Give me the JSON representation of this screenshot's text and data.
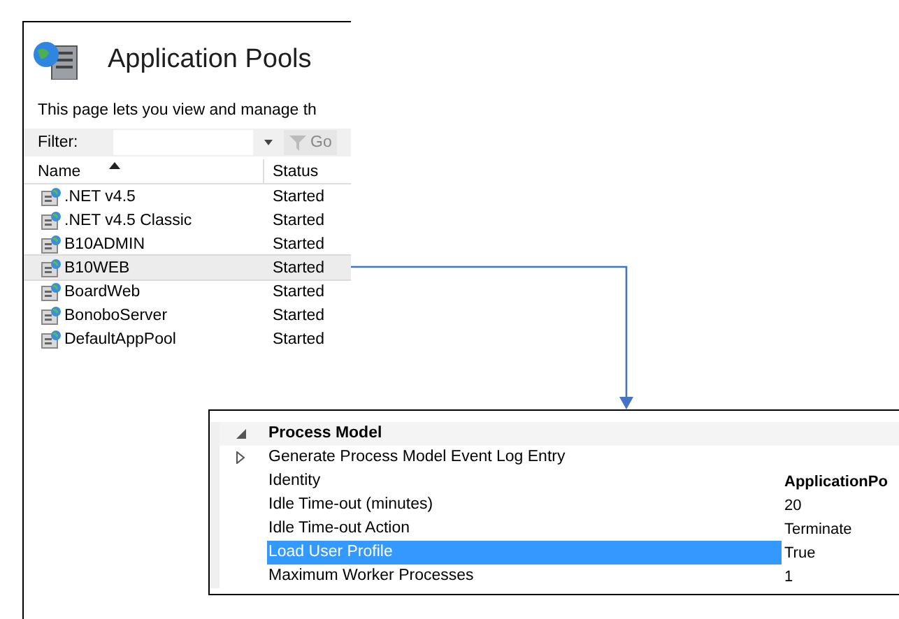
{
  "pools_panel": {
    "title": "Application Pools",
    "description": "This page lets you view and manage th",
    "filter": {
      "label": "Filter:",
      "go": "Go"
    },
    "columns": [
      {
        "label": "Name",
        "sorted": true
      },
      {
        "label": "Status",
        "sorted": false
      }
    ],
    "rows": [
      {
        "name": ".NET v4.5",
        "status": "Started",
        "selected": false
      },
      {
        "name": ".NET v4.5 Classic",
        "status": "Started",
        "selected": false
      },
      {
        "name": "B10ADMIN",
        "status": "Started",
        "selected": false
      },
      {
        "name": "B10WEB",
        "status": "Started",
        "selected": true
      },
      {
        "name": "BoardWeb",
        "status": "Started",
        "selected": false
      },
      {
        "name": "BonoboServer",
        "status": "Started",
        "selected": false
      },
      {
        "name": "DefaultAppPool",
        "status": "Started",
        "selected": false
      }
    ]
  },
  "settings_panel": {
    "rows": [
      {
        "kind": "section",
        "name": "Process Model",
        "expanded": true,
        "selected": false
      },
      {
        "kind": "collapsed",
        "name": "Generate Process Model Event Log Entry",
        "selected": false
      },
      {
        "kind": "setting",
        "name": "Identity",
        "value": "ApplicationPo",
        "bold_value": true,
        "selected": false
      },
      {
        "kind": "setting",
        "name": "Idle Time-out (minutes)",
        "value": "20",
        "selected": false
      },
      {
        "kind": "setting",
        "name": "Idle Time-out Action",
        "value": "Terminate",
        "selected": false
      },
      {
        "kind": "setting",
        "name": "Load User Profile",
        "value": "True",
        "selected": true
      },
      {
        "kind": "setting",
        "name": "Maximum Worker Processes",
        "value": "1",
        "selected": false
      }
    ]
  }
}
